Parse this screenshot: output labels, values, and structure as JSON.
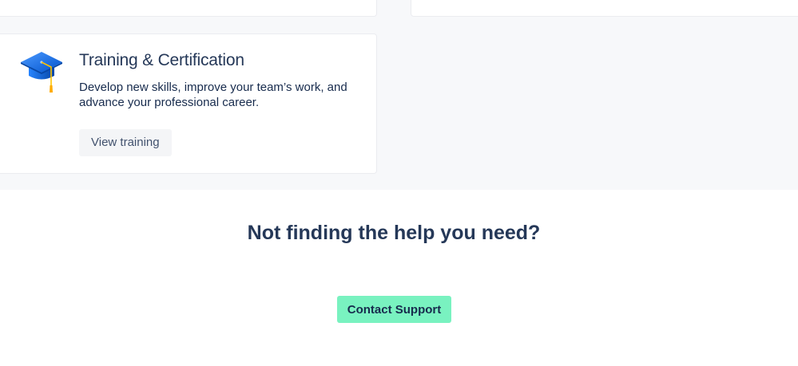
{
  "training_card": {
    "icon": "graduation-cap-icon",
    "title": "Training & Certification",
    "description": "Develop new skills, improve your team’s work, and advance your professional career.",
    "button_label": "View training"
  },
  "help_section": {
    "heading": "Not finding the help you need?",
    "button_label": "Contact Support"
  },
  "colors": {
    "band_background": "#f7f8fa",
    "contact_button": "#79f2c0",
    "heading_text": "#253858",
    "icon_blue": "#2684ff"
  }
}
